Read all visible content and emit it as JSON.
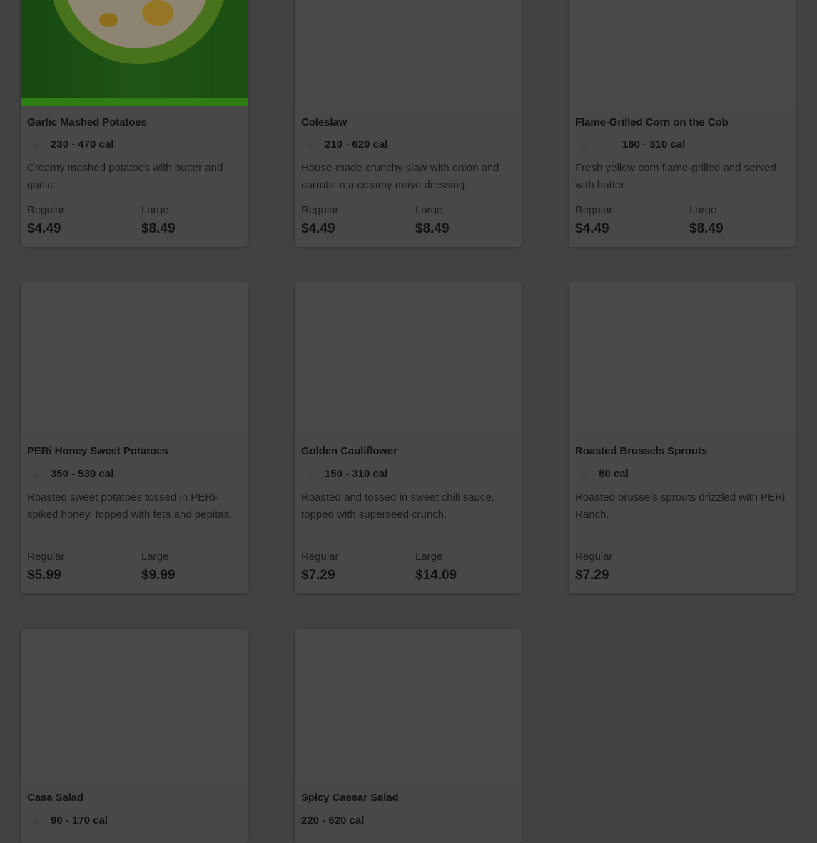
{
  "menu": {
    "items": [
      {
        "name": "Garlic Mashed Potatoes",
        "calories": "230 - 470 cal",
        "description": "Creamy mashed potatoes with butter and garlic.",
        "sizes": [
          {
            "label": "Regular",
            "price": "$4.49"
          },
          {
            "label": "Large",
            "price": "$8.49"
          }
        ]
      },
      {
        "name": "Coleslaw",
        "calories": "210 - 620 cal",
        "description": "House-made crunchy slaw with onion and carrots in a creamy mayo dressing.",
        "sizes": [
          {
            "label": "Regular",
            "price": "$4.49"
          },
          {
            "label": "Large",
            "price": "$8.49"
          }
        ]
      },
      {
        "name": "Flame-Grilled Corn on the Cob",
        "calories": "160 - 310 cal",
        "description": "Fresh yellow corn flame-grilled and served with butter.",
        "sizes": [
          {
            "label": "Regular",
            "price": "$4.49"
          },
          {
            "label": "Large",
            "price": "$8.49"
          }
        ]
      },
      {
        "name": "PERi Honey Sweet Potatoes",
        "calories": "350 - 530 cal",
        "description": "Roasted sweet potatoes tossed in PERi-spiked honey, topped with feta and pepitas.",
        "sizes": [
          {
            "label": "Regular",
            "price": "$5.99"
          },
          {
            "label": "Large",
            "price": "$9.99"
          }
        ]
      },
      {
        "name": "Golden Cauliflower",
        "calories": "150 - 310 cal",
        "description": "Roasted and tossed in sweet chili sauce, topped with superseed crunch.",
        "sizes": [
          {
            "label": "Regular",
            "price": "$7.29"
          },
          {
            "label": "Large",
            "price": "$14.09"
          }
        ]
      },
      {
        "name": "Roasted Brussels Sprouts",
        "calories": "80 cal",
        "description": "Roasted brussels sprouts drizzled with PERi Ranch.",
        "sizes": [
          {
            "label": "Regular",
            "price": "$7.29"
          }
        ]
      },
      {
        "name": "Casa Salad",
        "calories": "90 - 170 cal"
      },
      {
        "name": "Spicy Caesar Salad",
        "calories": "220 - 620 cal"
      }
    ]
  },
  "icons": {
    "calorie": "flame-icon"
  },
  "colors": {
    "overlay_background": "#424242",
    "card_background": "#484848"
  }
}
